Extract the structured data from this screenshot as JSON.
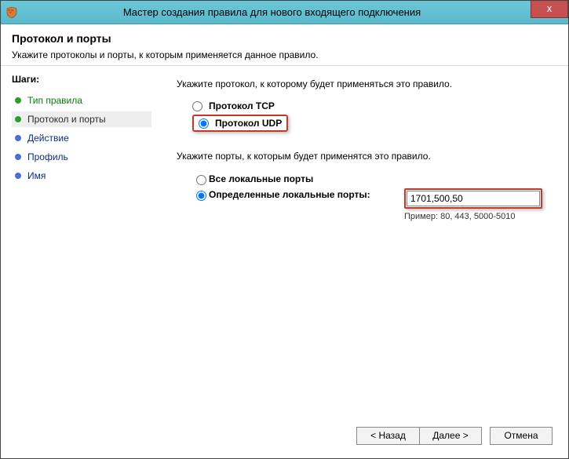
{
  "window": {
    "title": "Мастер создания правила для нового входящего подключения",
    "close_label": "x"
  },
  "header": {
    "title": "Протокол и порты",
    "subtitle": "Укажите протоколы и порты, к которым применяется данное правило."
  },
  "sidebar": {
    "title": "Шаги:",
    "steps": [
      {
        "label": "Тип правила",
        "state": "done"
      },
      {
        "label": "Протокол и порты",
        "state": "current"
      },
      {
        "label": "Действие",
        "state": "pending"
      },
      {
        "label": "Профиль",
        "state": "pending"
      },
      {
        "label": "Имя",
        "state": "pending"
      }
    ]
  },
  "content": {
    "protocol_prompt": "Укажите протокол, к которому будет применяться это правило.",
    "protocol_options": {
      "tcp": "Протокол TCP",
      "udp": "Протокол UDP",
      "selected": "udp"
    },
    "ports_prompt": "Укажите порты, к которым будет применятся это правило.",
    "ports_options": {
      "all": "Все локальные порты",
      "specific": "Определенные локальные порты:",
      "selected": "specific"
    },
    "ports_value": "1701,500,50",
    "ports_example": "Пример: 80, 443, 5000-5010"
  },
  "footer": {
    "back": "< Назад",
    "next": "Далее >",
    "cancel": "Отмена"
  }
}
